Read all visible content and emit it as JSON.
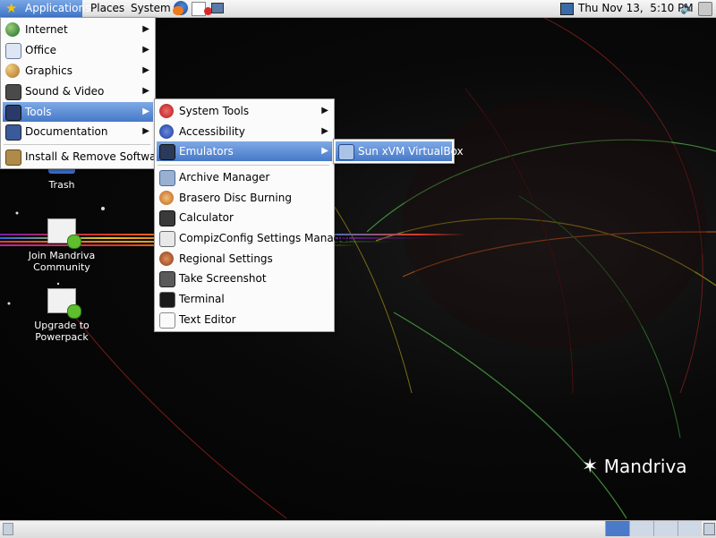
{
  "top_panel": {
    "applications": "Applications",
    "places": "Places",
    "system": "System",
    "clock": "Thu Nov 13,  5:10 PM"
  },
  "app_menu": {
    "items": [
      {
        "label": "Internet",
        "icon": "globe-icon"
      },
      {
        "label": "Office",
        "icon": "office-icon"
      },
      {
        "label": "Graphics",
        "icon": "palette-icon"
      },
      {
        "label": "Sound & Video",
        "icon": "media-icon"
      },
      {
        "label": "Tools",
        "icon": "tools-icon"
      },
      {
        "label": "Documentation",
        "icon": "book-icon"
      },
      {
        "label": "Install & Remove Software",
        "icon": "package-icon"
      }
    ]
  },
  "tools_menu": {
    "items": [
      {
        "label": "System Tools"
      },
      {
        "label": "Accessibility"
      },
      {
        "label": "Emulators"
      },
      {
        "label": "Archive Manager"
      },
      {
        "label": "Brasero Disc Burning"
      },
      {
        "label": "Calculator"
      },
      {
        "label": "CompizConfig Settings Manager"
      },
      {
        "label": "Regional Settings"
      },
      {
        "label": "Take Screenshot"
      },
      {
        "label": "Terminal"
      },
      {
        "label": "Text Editor"
      }
    ]
  },
  "emulators_menu": {
    "items": [
      {
        "label": "Sun xVM VirtualBox"
      }
    ]
  },
  "desktop": {
    "icons": [
      {
        "label": "Trash"
      },
      {
        "label": "Join Mandriva Community"
      },
      {
        "label": "Upgrade to Powerpack"
      }
    ],
    "brand": "Mandriva"
  },
  "colors": {
    "highlight": "#4679c8",
    "panel": "#e6e6e6"
  }
}
